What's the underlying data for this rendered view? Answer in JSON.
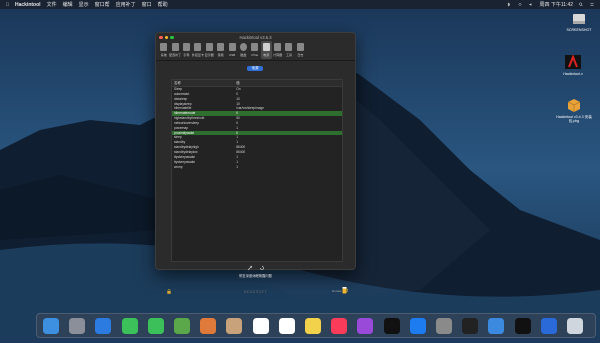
{
  "menubar": {
    "app": "Hackintool",
    "items": [
      "文件",
      "编辑",
      "显示",
      "窗口帮",
      "应用补丁",
      "窗口",
      "帮助"
    ],
    "clock": "周四 下午11:42"
  },
  "desktop": {
    "icons": [
      {
        "label": "SCREENSHOT"
      },
      {
        "label": "Hackintool.v"
      },
      {
        "label": "Hackintool v3.4.3 安装包.pkg"
      }
    ]
  },
  "window": {
    "title": "Hackintool v3.5.3",
    "toolbar": [
      "系统",
      "配置补丁",
      "引导",
      "外接显卡",
      "显示器",
      "音频",
      "USB",
      "磁盘",
      "PCIe",
      "电源",
      "计算器",
      "工具",
      "日志"
    ],
    "active_tab_index": 9,
    "pill_button": "电源",
    "table": {
      "headers": [
        "名称",
        "值"
      ],
      "rows": [
        {
          "name": "Sleep",
          "value": "On"
        },
        {
          "name": "autorestart",
          "value": "0"
        },
        {
          "name": "disksleep",
          "value": "10"
        },
        {
          "name": "displaysleep",
          "value": "10"
        },
        {
          "name": "hibernatefile",
          "value": "/var/vm/sleepimage"
        },
        {
          "name": "hibernatemode",
          "value": "0",
          "highlight": true
        },
        {
          "name": "highstandbythreshold",
          "value": "50"
        },
        {
          "name": "networkoversleep",
          "value": "0"
        },
        {
          "name": "powernap",
          "value": "1"
        },
        {
          "name": "proximitywake",
          "value": "0",
          "highlight": true
        },
        {
          "name": "sleep",
          "value": "1"
        },
        {
          "name": "standby",
          "value": "1"
        },
        {
          "name": "standbydelayhigh",
          "value": "86400"
        },
        {
          "name": "standbydelaylow",
          "value": "86400"
        },
        {
          "name": "ttyskeepawake",
          "value": "1"
        },
        {
          "name": "ttyskeepawake",
          "value": "1"
        },
        {
          "name": "womp",
          "value": "1"
        }
      ]
    },
    "bottom_text": "修复深度休眠唤醒问题",
    "brand": "HEADSOFT",
    "donate_label": "Donate"
  },
  "dock_apps": [
    "Finder",
    "Launchpad",
    "Safari",
    "Messages",
    "FaceTime",
    "Maps",
    "Photos",
    "Contacts",
    "Calendar",
    "Reminders",
    "Notes",
    "Music",
    "Podcasts",
    "TV",
    "App Store",
    "System Preferences",
    "Terminal",
    "Mail",
    "Hackintool",
    "Downloads",
    "Trash"
  ]
}
